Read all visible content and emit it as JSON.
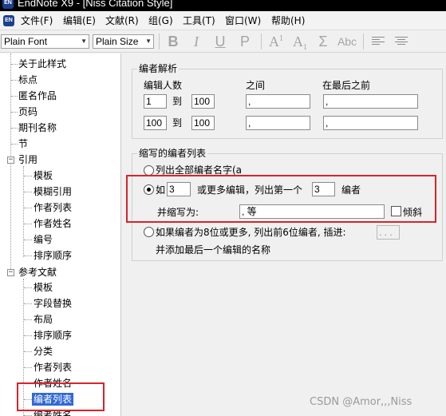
{
  "window": {
    "app_icon": "EN",
    "title": "EndNote X9 - [Niss Citation Style]"
  },
  "menu": [
    "文件(F)",
    "编辑(E)",
    "文献(R)",
    "组(G)",
    "工具(T)",
    "窗口(W)",
    "帮助(H)"
  ],
  "toolbar": {
    "font_value": "Plain Font",
    "size_value": "Plain Size",
    "bold_label": "B",
    "italic_label": "I",
    "underline_label": "U",
    "plain_label": "P",
    "superscript_main": "A",
    "superscript_mark": "1",
    "subscript_main": "A",
    "subscript_mark": "1",
    "symbol_label": "Σ",
    "smallcaps_label": "Abc",
    "icons": [
      "bold-icon",
      "italic-icon",
      "underline-icon",
      "plain-icon",
      "superscript-icon",
      "subscript-icon",
      "sigma-icon",
      "small-caps-icon",
      "align-left-icon",
      "align-center-icon"
    ]
  },
  "tree": {
    "top_items": [
      "关于此样式",
      "标点",
      "匿名作品",
      "页码",
      "期刊名称",
      "节"
    ],
    "citation_group": {
      "label": "引用",
      "toggle": "−",
      "children": [
        "模板",
        "模糊引用",
        "作者列表",
        "作者姓名",
        "编号",
        "排序顺序"
      ]
    },
    "bibliography_group": {
      "label": "参考文献",
      "toggle": "−",
      "children": [
        "模板",
        "字段替换",
        "布局",
        "排序顺序",
        "分类",
        "作者列表",
        "作者姓名",
        "编者列表",
        "编者姓名"
      ]
    },
    "selected": "编者列表"
  },
  "panel": {
    "editor_parsing": {
      "title": "编者解析",
      "col_count": "编辑人数",
      "col_between": "之间",
      "col_before_last": "在最后之前",
      "to_label": "到",
      "rows": [
        {
          "from": "1",
          "to": "100",
          "between": ",",
          "before_last": ","
        },
        {
          "from": "100",
          "to": "100",
          "between": ",",
          "before_last": ","
        }
      ]
    },
    "abbreviated_list": {
      "title": "缩写的编者列表",
      "option_all": "列出全部编者名字(a",
      "option_if_prefix": "如",
      "if_count": "3",
      "option_if_middle": "或更多编辑，列出第一个",
      "list_first": "3",
      "option_if_suffix": "编者",
      "abbreviate_label": "并缩写为:",
      "abbreviate_value": ", 等",
      "italic_label": "倾斜",
      "option_eight": "如果编者为8位或更多, 列出前6位编者, 插进:",
      "ellipsis_value": ". . .",
      "option_eight_line2": "并添加最后一个编辑的名称",
      "selected_option": "if"
    }
  },
  "watermark": "CSDN @Amor,,,Niss",
  "colors": {
    "highlight_box": "#d9232b",
    "selection": "#3068d6",
    "title_bar": "#000000"
  }
}
